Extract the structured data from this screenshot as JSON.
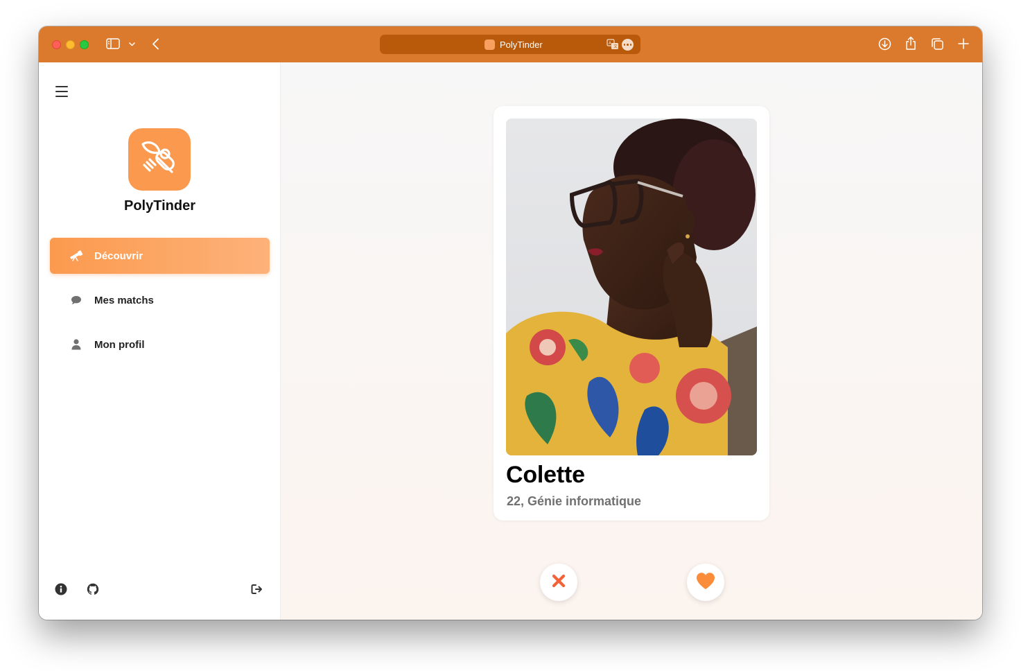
{
  "browser": {
    "tab_title": "PolyTinder",
    "accent_color": "#db7a2c",
    "toolbar_icons": [
      "sidebar-icon",
      "chevron-down-icon",
      "back-icon",
      "translate-icon",
      "more-icon",
      "download-icon",
      "share-icon",
      "tabs-icon",
      "new-tab-icon"
    ]
  },
  "sidebar": {
    "app_name": "PolyTinder",
    "brand_color": "#fb9a4e",
    "nav": [
      {
        "label": "Découvrir",
        "icon": "telescope-icon",
        "active": true
      },
      {
        "label": "Mes matchs",
        "icon": "chat-bubble-icon",
        "active": false
      },
      {
        "label": "Mon profil",
        "icon": "user-icon",
        "active": false
      }
    ],
    "footer_icons": [
      "info-icon",
      "github-icon",
      "logout-icon"
    ]
  },
  "profile_card": {
    "name": "Colette",
    "details": "22, Génie informatique"
  },
  "actions": {
    "dislike_icon": "close-icon",
    "dislike_color": "#f4623a",
    "like_icon": "heart-icon",
    "like_color": "#fb8c3a"
  }
}
